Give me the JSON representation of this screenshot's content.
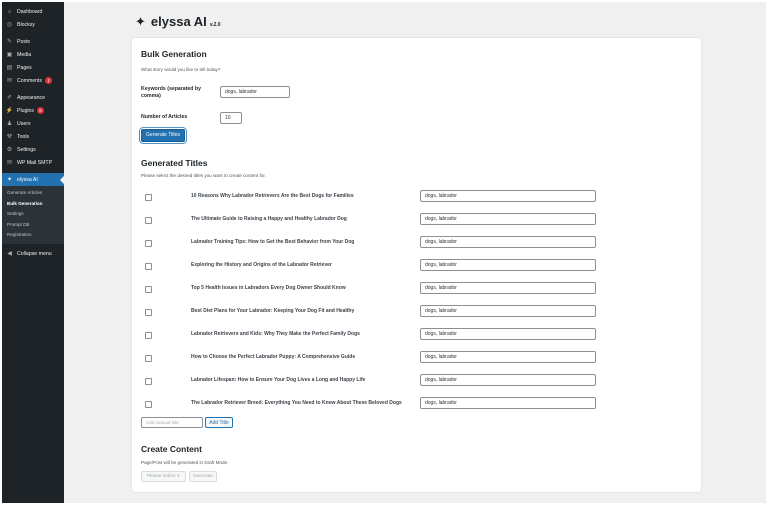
{
  "sidebar": {
    "items": [
      {
        "label": "Dashboard",
        "icon": "dashboard-icon",
        "glyph": "⌂"
      },
      {
        "label": "Blocksy",
        "icon": "blocksy-icon",
        "glyph": "◎"
      },
      {
        "label": "Posts",
        "icon": "pin-icon",
        "glyph": "✎"
      },
      {
        "label": "Media",
        "icon": "media-icon",
        "glyph": "▣"
      },
      {
        "label": "Pages",
        "icon": "pages-icon",
        "glyph": "▤"
      },
      {
        "label": "Comments",
        "icon": "comments-icon",
        "glyph": "✉",
        "badge": "1"
      },
      {
        "label": "Appearance",
        "icon": "brush-icon",
        "glyph": "✐"
      },
      {
        "label": "Plugins",
        "icon": "plugins-icon",
        "glyph": "⚡",
        "badge": "8"
      },
      {
        "label": "Users",
        "icon": "users-icon",
        "glyph": "♟"
      },
      {
        "label": "Tools",
        "icon": "tools-icon",
        "glyph": "⚒"
      },
      {
        "label": "Settings",
        "icon": "settings-icon",
        "glyph": "⚙"
      },
      {
        "label": "WP Mail SMTP",
        "icon": "mail-icon",
        "glyph": "✉"
      },
      {
        "label": "elyssa AI",
        "icon": "sparkle-icon",
        "glyph": "✦"
      }
    ],
    "submenu": [
      "Generate Articles",
      "Bulk Generation",
      "Settings",
      "Prompt DB",
      "Registration"
    ],
    "current_sub": "Bulk Generation",
    "collapse_label": "Collapse menu"
  },
  "brand": {
    "name": "elyssa AI",
    "version": "v.2.0"
  },
  "bulk": {
    "heading": "Bulk Generation",
    "subtitle": "What story would you like to tell today?",
    "keywords_label": "Keywords (separated by comma)",
    "keywords_value": "dogs, labrador",
    "articles_label": "Number of Articles",
    "articles_value": "10",
    "generate_titles_label": "Generate Titles"
  },
  "generated": {
    "heading": "Generated Titles",
    "subtitle": "Please select the desired titles you want to create content for.",
    "rows": [
      {
        "title": "10 Reasons Why Labrador Retrievers Are the Best Dogs for Families",
        "keywords": "dogs, labrador"
      },
      {
        "title": "The Ultimate Guide to Raising a Happy and Healthy Labrador Dog",
        "keywords": "dogs, labrador"
      },
      {
        "title": "Labrador Training Tips: How to Get the Best Behavior from Your Dog",
        "keywords": "dogs, labrador"
      },
      {
        "title": "Exploring the History and Origins of the Labrador Retriever",
        "keywords": "dogs, labrador"
      },
      {
        "title": "Top 5 Health Issues in Labradors Every Dog Owner Should Know",
        "keywords": "dogs, labrador"
      },
      {
        "title": "Best Diet Plans for Your Labrador: Keeping Your Dog Fit and Healthy",
        "keywords": "dogs, labrador"
      },
      {
        "title": "Labrador Retrievers and Kids: Why They Make the Perfect Family Dogs",
        "keywords": "dogs, labrador"
      },
      {
        "title": "How to Choose the Perfect Labrador Puppy: A Comprehensive Guide",
        "keywords": "dogs, labrador"
      },
      {
        "title": "Labrador Lifespan: How to Ensure Your Dog Lives a Long and Happy Life",
        "keywords": "dogs, labrador"
      },
      {
        "title": "The Labrador Retriever Breed: Everything You Need to Know About These Beloved Dogs",
        "keywords": "dogs, labrador"
      }
    ],
    "manual_placeholder": "Add manual title",
    "add_title_label": "Add Title"
  },
  "create": {
    "heading": "Create Content",
    "subtitle": "Page/Post will be generated in Draft Mode.",
    "select_placeholder": "Please select ∨",
    "generate_label": "Generate"
  },
  "colors": {
    "accent": "#2271b1",
    "sidebar": "#1d2327",
    "badge": "#d63638"
  }
}
